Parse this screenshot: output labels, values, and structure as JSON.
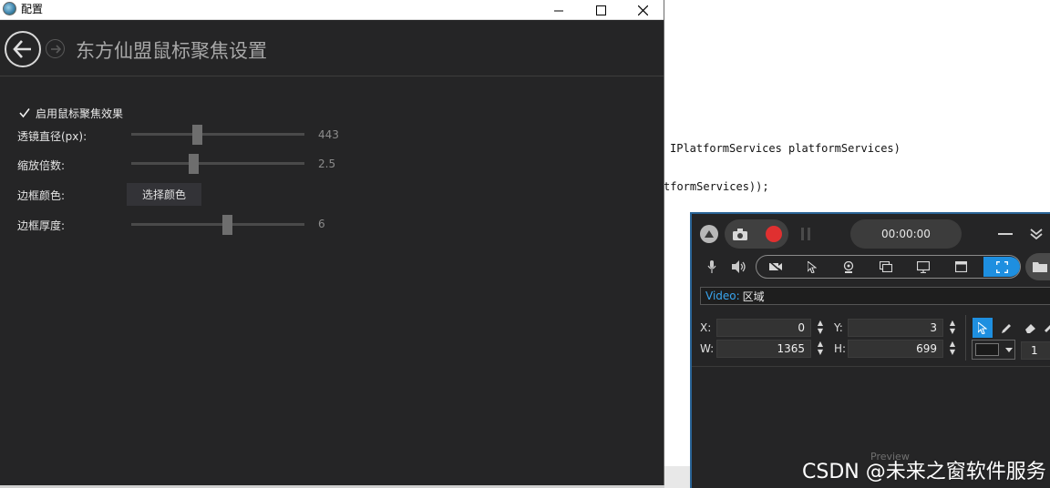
{
  "config_window": {
    "title": "配置",
    "page_title": "东方仙盟鼠标聚焦设置",
    "enable_label": "启用鼠标聚焦效果",
    "enable_checked": true,
    "settings": [
      {
        "label": "透镜直径(px):",
        "value": "443",
        "slider_fraction": 0.38
      },
      {
        "label": "缩放倍数:",
        "value": "2.5",
        "slider_fraction": 0.35
      },
      {
        "label": "边框颜色:",
        "button": "选择颜色"
      },
      {
        "label": "边框厚度:",
        "value": "6",
        "slider_fraction": 0.55
      }
    ]
  },
  "code_editor": {
    "lines": [
      "IPlatformServices platformServices)",
      "tformServices));"
    ]
  },
  "recorder": {
    "timer": "00:00:00",
    "video_label": "Video:",
    "video_value": "区域",
    "x_label": "X:",
    "x_value": "0",
    "y_label": "Y:",
    "y_value": "3",
    "w_label": "W:",
    "w_value": "1365",
    "h_label": "H:",
    "h_value": "699",
    "partial_value": "1",
    "preview_label": "Preview",
    "record_color": "#e03030",
    "accent_color": "#1e8fe0"
  },
  "watermark": "CSDN @未来之窗软件服务"
}
